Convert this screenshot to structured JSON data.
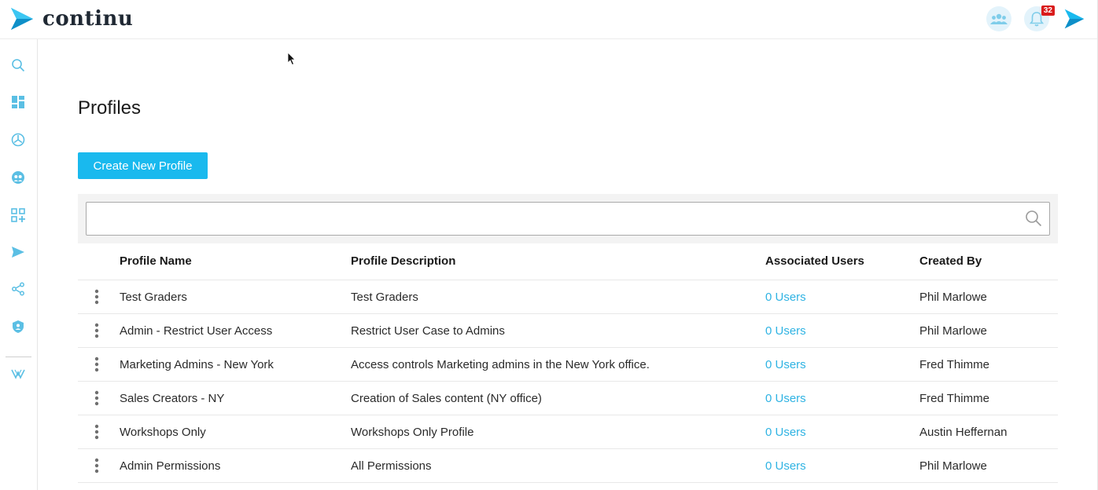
{
  "app": {
    "logo_text": "continu",
    "brand_color": "#19b9ee",
    "notification_count": "32"
  },
  "top_icons": [
    "team-icon",
    "bell-icon",
    "continu-logo-icon"
  ],
  "sidebar": {
    "items": [
      {
        "icon": "search-icon"
      },
      {
        "icon": "dashboard-icon"
      },
      {
        "icon": "analytics-icon"
      },
      {
        "icon": "users-icon"
      },
      {
        "icon": "add-apps-icon"
      },
      {
        "icon": "send-icon"
      },
      {
        "icon": "share-icon"
      },
      {
        "icon": "shield-icon"
      },
      {
        "icon": "workshop-icon"
      }
    ]
  },
  "page": {
    "title": "Profiles",
    "create_button": "Create New Profile",
    "search_placeholder": ""
  },
  "table": {
    "columns": {
      "name": "Profile Name",
      "description": "Profile Description",
      "users": "Associated Users",
      "created_by": "Created By"
    },
    "rows": [
      {
        "name": "Test Graders",
        "description": "Test Graders",
        "users": "0 Users",
        "created_by": "Phil Marlowe"
      },
      {
        "name": "Admin - Restrict User Access",
        "description": "Restrict User Case to Admins",
        "users": "0 Users",
        "created_by": "Phil Marlowe"
      },
      {
        "name": "Marketing Admins - New York",
        "description": "Access controls Marketing admins in the New York office.",
        "users": "0 Users",
        "created_by": "Fred Thimme"
      },
      {
        "name": "Sales Creators - NY",
        "description": "Creation of Sales content (NY office)",
        "users": "0 Users",
        "created_by": "Fred Thimme"
      },
      {
        "name": "Workshops Only",
        "description": "Workshops Only Profile",
        "users": "0 Users",
        "created_by": "Austin Heffernan"
      },
      {
        "name": "Admin Permissions",
        "description": "All Permissions",
        "users": "0 Users",
        "created_by": "Phil Marlowe"
      }
    ]
  }
}
